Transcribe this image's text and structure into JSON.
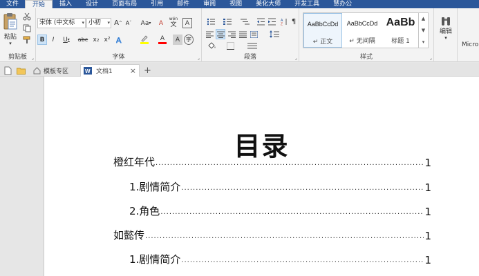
{
  "ribbon_tabs": [
    "文件",
    "开始",
    "插入",
    "设计",
    "页面布局",
    "引用",
    "邮件",
    "审阅",
    "视图",
    "美化大师",
    "开发工具",
    "慧办公"
  ],
  "active_tab": "开始",
  "groups": {
    "clipboard": {
      "label": "剪贴板",
      "paste_label": "粘贴"
    },
    "font": {
      "label": "字体",
      "font_name": "宋体 (中文标",
      "font_size": "小初",
      "phonetic_label": "wén",
      "phonetic_char": "文",
      "format_buttons": [
        "B",
        "I",
        "U",
        "abc",
        "x₂",
        "x²"
      ],
      "grow_label": "A",
      "shrink_label": "A",
      "case_label": "Aa",
      "clear_label": "A",
      "border_label": "A",
      "color_label": "A",
      "char_shade_label": "A",
      "enclose_label": "字"
    },
    "paragraph": {
      "label": "段落"
    },
    "styles": {
      "label": "样式",
      "items": [
        {
          "sample": "AaBbCcDd",
          "name": "↵ 正文"
        },
        {
          "sample": "AaBbCcDd",
          "name": "↵ 无间隔"
        },
        {
          "sample": "AaBb",
          "name": "标题 1"
        }
      ]
    },
    "editing": {
      "label": "编辑"
    },
    "extra": {
      "label": "Micro"
    }
  },
  "doc_tabs": [
    {
      "label": "模板专区"
    },
    {
      "label": "文档1"
    }
  ],
  "new_tab_label": "+",
  "close_glyph": "×",
  "document": {
    "title": "目录",
    "toc": [
      {
        "text": "橙红年代",
        "page": "1",
        "level": 1
      },
      {
        "text": "1.剧情简介",
        "page": "1",
        "level": 2
      },
      {
        "text": "2.角色",
        "page": "1",
        "level": 2
      },
      {
        "text": "如懿传",
        "page": "1",
        "level": 1
      },
      {
        "text": "1.剧情简介",
        "page": "1",
        "level": 2
      }
    ]
  },
  "colors": {
    "accent": "#2b579a",
    "highlight": "#ffff00",
    "font_color": "#ff0000"
  }
}
